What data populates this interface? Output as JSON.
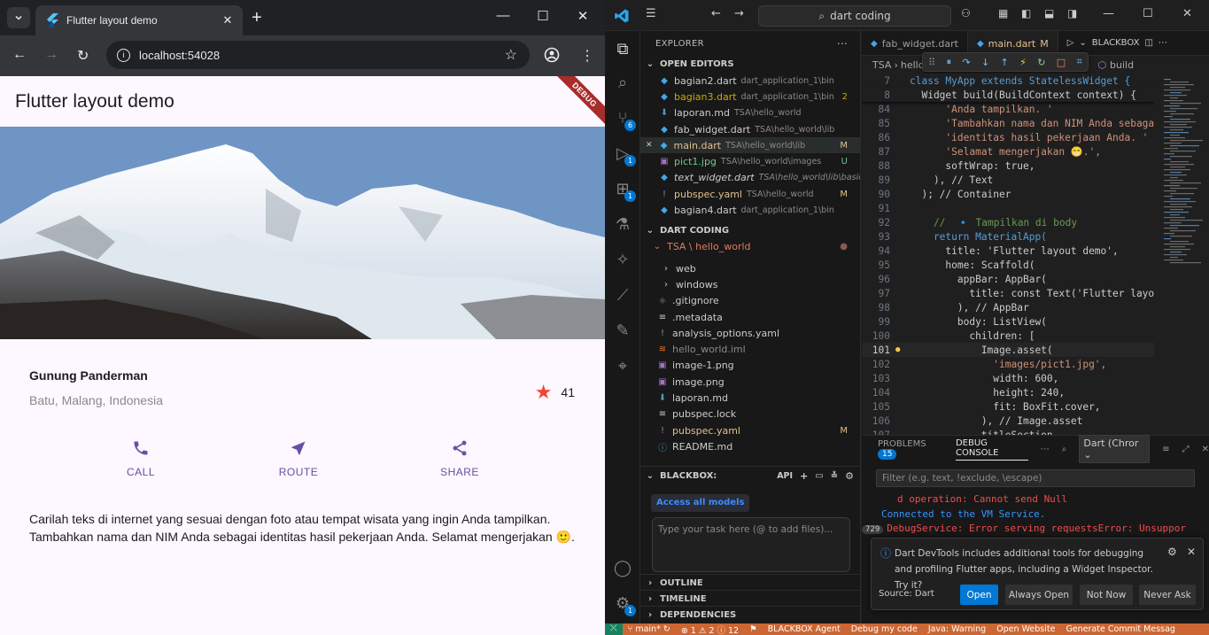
{
  "browser": {
    "tab_title": "Flutter layout demo",
    "url": "localhost:54028"
  },
  "app": {
    "title": "Flutter layout demo",
    "debug_banner": "DEBUG",
    "place_name": "Gunung Panderman",
    "place_location": "Batu, Malang, Indonesia",
    "rating": "41",
    "actions": [
      {
        "label": "CALL",
        "icon": "phone-icon"
      },
      {
        "label": "ROUTE",
        "icon": "navigation-icon"
      },
      {
        "label": "SHARE",
        "icon": "share-icon"
      }
    ],
    "description": "Carilah teks di internet yang sesuai dengan foto atau tempat wisata yang ingin Anda tampilkan. Tambahkan nama dan NIM Anda sebagai identitas hasil pekerjaan Anda. Selamat mengerjakan 🙂.",
    "colors": {
      "primary": "#6750a4",
      "star": "#f44336",
      "background": "#fdf7ff"
    }
  },
  "vscode": {
    "search": "dart coding",
    "explorer_title": "EXPLORER",
    "open_editors_title": "OPEN EDITORS",
    "open_editors": [
      {
        "name": "bagian2.dart",
        "path": "dart_application_1\\bin",
        "status": "",
        "color": "#cccccc",
        "icon": "dart-icon"
      },
      {
        "name": "bagian3.dart",
        "path": "dart_application_1\\bin",
        "status": "2",
        "color": "#cca700",
        "icon": "dart-icon"
      },
      {
        "name": "laporan.md",
        "path": "TSA\\hello_world",
        "status": "",
        "color": "#cccccc",
        "icon": "markdown-icon"
      },
      {
        "name": "fab_widget.dart",
        "path": "TSA\\hello_world\\lib",
        "status": "",
        "color": "#cccccc",
        "icon": "dart-icon"
      },
      {
        "name": "main.dart",
        "path": "TSA\\hello_world\\lib",
        "status": "M",
        "color": "#e2c08d",
        "icon": "dart-icon"
      },
      {
        "name": "pict1.jpg",
        "path": "TSA\\hello_world\\images",
        "status": "U",
        "color": "#73c991",
        "icon": "image-icon"
      },
      {
        "name": "text_widget.dart",
        "path": "TSA\\hello_world\\lib\\basic...",
        "status": "",
        "color": "#cccccc",
        "icon": "dart-icon"
      },
      {
        "name": "pubspec.yaml",
        "path": "TSA\\hello_world",
        "status": "M",
        "color": "#e2c08d",
        "icon": "yaml-icon"
      },
      {
        "name": "bagian4.dart",
        "path": "dart_application_1\\bin",
        "status": "",
        "color": "#cccccc",
        "icon": "dart-icon"
      }
    ],
    "workspace_title": "DART CODING",
    "root_folder": "TSA \\ hello_world",
    "files": [
      {
        "name": "web",
        "type": "folder",
        "color": "#cccccc",
        "status": ""
      },
      {
        "name": "windows",
        "type": "folder",
        "color": "#cccccc",
        "status": ""
      },
      {
        "name": ".gitignore",
        "type": "file",
        "color": "#cccccc",
        "status": ""
      },
      {
        "name": ".metadata",
        "type": "file",
        "color": "#cccccc",
        "status": ""
      },
      {
        "name": "analysis_options.yaml",
        "type": "file",
        "color": "#cccccc",
        "status": ""
      },
      {
        "name": "hello_world.iml",
        "type": "file",
        "color": "#8a8a8a",
        "status": ""
      },
      {
        "name": "image-1.png",
        "type": "file",
        "color": "#cccccc",
        "status": ""
      },
      {
        "name": "image.png",
        "type": "file",
        "color": "#cccccc",
        "status": ""
      },
      {
        "name": "laporan.md",
        "type": "file",
        "color": "#cccccc",
        "status": ""
      },
      {
        "name": "pubspec.lock",
        "type": "file",
        "color": "#cccccc",
        "status": ""
      },
      {
        "name": "pubspec.yaml",
        "type": "file",
        "color": "#e2c08d",
        "status": "M"
      },
      {
        "name": "README.md",
        "type": "file",
        "color": "#cccccc",
        "status": ""
      }
    ],
    "blackbox_title": "BLACKBOX:",
    "blackbox_api": "API",
    "access_models": "Access all models",
    "task_placeholder": "Type your task here (@ to add files)...",
    "outline": "OUTLINE",
    "timeline": "TIMELINE",
    "dependencies": "DEPENDENCIES",
    "tabs": [
      {
        "label": "fab_widget.dart",
        "active": false
      },
      {
        "label": "main.dart",
        "active": true,
        "status": "M"
      }
    ],
    "blackbox_label": "BLACKBOX",
    "breadcrumb": [
      "TSA",
      "hello",
      "build"
    ],
    "code_lines": [
      {
        "n": "7",
        "sticky": true,
        "text": "class MyApp extends StatelessWidget {"
      },
      {
        "n": "8",
        "sticky": true,
        "text": "  Widget build(BuildContext context) {"
      },
      {
        "n": "84",
        "text": "      'Anda tampilkan. '"
      },
      {
        "n": "85",
        "text": "      'Tambahkan nama dan NIM Anda sebagai '"
      },
      {
        "n": "86",
        "text": "      'identitas hasil pekerjaan Anda. '"
      },
      {
        "n": "87",
        "text": "      'Selamat mengerjakan 😁.',"
      },
      {
        "n": "88",
        "text": "      softWrap: true,"
      },
      {
        "n": "89",
        "text": "    ), // Text"
      },
      {
        "n": "90",
        "text": "  ); // Container"
      },
      {
        "n": "91",
        "text": ""
      },
      {
        "n": "92",
        "text": "    //  🔹 Tampilkan di body"
      },
      {
        "n": "93",
        "text": "    return MaterialApp("
      },
      {
        "n": "94",
        "text": "      title: 'Flutter layout demo',"
      },
      {
        "n": "95",
        "text": "      home: Scaffold("
      },
      {
        "n": "96",
        "text": "        appBar: AppBar("
      },
      {
        "n": "97",
        "text": "          title: const Text('Flutter layout"
      },
      {
        "n": "98",
        "text": "        ), // AppBar"
      },
      {
        "n": "99",
        "text": "        body: ListView("
      },
      {
        "n": "100",
        "text": "          children: ["
      },
      {
        "n": "101",
        "text": "            Image.asset(",
        "current": true
      },
      {
        "n": "102",
        "text": "              'images/pict1.jpg',"
      },
      {
        "n": "103",
        "text": "              width: 600,"
      },
      {
        "n": "104",
        "text": "              height: 240,"
      },
      {
        "n": "105",
        "text": "              fit: BoxFit.cover,"
      },
      {
        "n": "106",
        "text": "            ), // Image.asset"
      },
      {
        "n": "107",
        "text": "            titleSection,"
      }
    ],
    "panel": {
      "problems": "PROBLEMS",
      "problems_count": "15",
      "debug_console": "DEBUG CONSOLE",
      "selector": "Dart (Chror",
      "filter_placeholder": "Filter (e.g. text, !exclude, \\escape)",
      "console_lines": [
        {
          "text": "d operation: Cannot send Null",
          "color": "#f14c4c",
          "badge": ""
        },
        {
          "text": "Connected to the VM Service.",
          "color": "#3794ff",
          "badge": ""
        },
        {
          "text": "DebugService: Error serving requestsError: Unsuppor",
          "color": "#f14c4c",
          "badge": "729"
        }
      ],
      "toast_text": "Dart DevTools includes additional tools for debugging and profiling Flutter apps, including a Widget Inspector. Try it?",
      "toast_source": "Source: Dart",
      "toast_buttons": [
        "Open",
        "Always Open",
        "Not Now",
        "Never Ask"
      ]
    },
    "status": {
      "branch": "main*",
      "errors": "1",
      "warnings": "2",
      "info": "12",
      "items": [
        "BLACKBOX Agent",
        "Debug my code",
        "Java: Warning",
        "Open Website",
        "Generate Commit Messag"
      ]
    }
  }
}
